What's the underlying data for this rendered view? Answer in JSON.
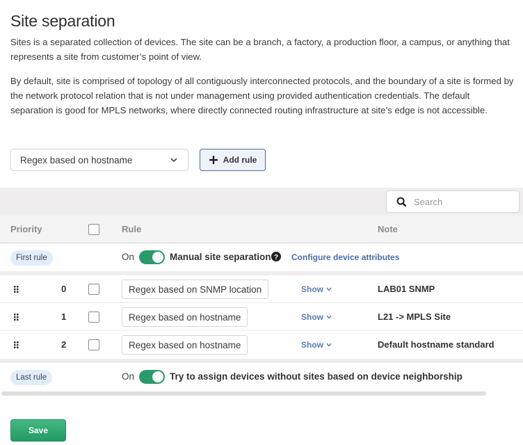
{
  "header": {
    "title": "Site separation",
    "description_1": "Sites is a separated collection of devices. The site can be a branch, a factory, a production floor, a campus, or anything that represents a site from customer’s point of view.",
    "description_2": "By default, site is comprised of topology of all contiguously interconnected protocols, and the boundary of a site is formed by the network protocol relation that is not under management using provided authentication credentials. The default separation is good for MPLS networks, where directly connected routing infrastructure at site’s edge is not accessible."
  },
  "controls": {
    "rule_type_selected": "Regex based on hostname",
    "add_rule_label": "Add rule"
  },
  "table": {
    "search_placeholder": "Search",
    "columns": {
      "priority": "Priority",
      "rule": "Rule",
      "note": "Note"
    },
    "first_rule": {
      "badge": "First rule",
      "state_label": "On",
      "enabled": true,
      "text": "Manual site separation",
      "link": "Configure device attributes"
    },
    "rows": [
      {
        "priority": "0",
        "rule": "Regex based on SNMP location",
        "show_label": "Show",
        "note": "LAB01 SNMP"
      },
      {
        "priority": "1",
        "rule": "Regex based on hostname",
        "show_label": "Show",
        "note": "L21 -> MPLS Site"
      },
      {
        "priority": "2",
        "rule": "Regex based on hostname",
        "show_label": "Show",
        "note": "Default hostname standard"
      }
    ],
    "last_rule": {
      "badge": "Last rule",
      "state_label": "On",
      "enabled": true,
      "text": "Try to assign devices without sites based on device neighborship"
    }
  },
  "footer": {
    "save_label": "Save"
  },
  "colors": {
    "accent_green": "#2a9a6a",
    "link_blue": "#4a6ea8",
    "badge_bg": "#e1edf9"
  }
}
